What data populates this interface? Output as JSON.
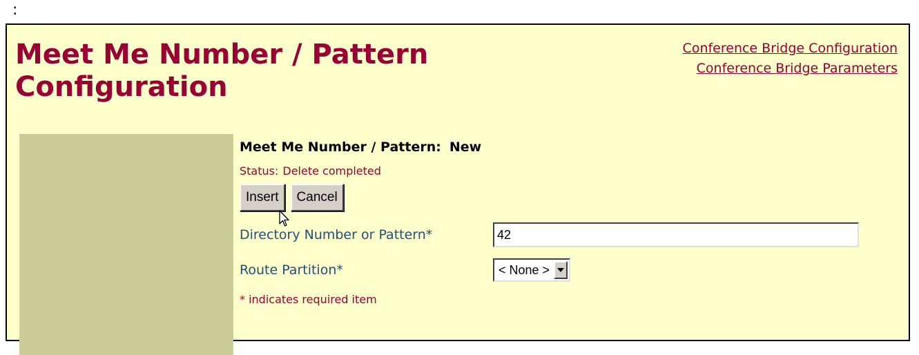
{
  "caption_prefix": ":",
  "page_title": "Meet Me Number / Pattern Configuration",
  "related_links": [
    {
      "label": "Conference Bridge Configuration"
    },
    {
      "label": "Conference Bridge Parameters"
    }
  ],
  "entity": {
    "label": "Meet Me Number / Pattern:",
    "value": "New"
  },
  "status": {
    "label": "Status:",
    "text": "Delete completed"
  },
  "buttons": {
    "insert": "Insert",
    "cancel": "Cancel"
  },
  "fields": {
    "directory_number": {
      "label": "Directory Number or Pattern*",
      "value": "42"
    },
    "route_partition": {
      "label": "Route Partition*",
      "selected": "< None >"
    }
  },
  "required_note": "* indicates required item",
  "colors": {
    "title": "#990033",
    "background": "#ffffcc",
    "sidebar": "#cccc99",
    "field_label": "#1f4e79"
  },
  "icons": {
    "cursor": "mouse-pointer-icon",
    "dropdown": "chevron-down-icon"
  }
}
